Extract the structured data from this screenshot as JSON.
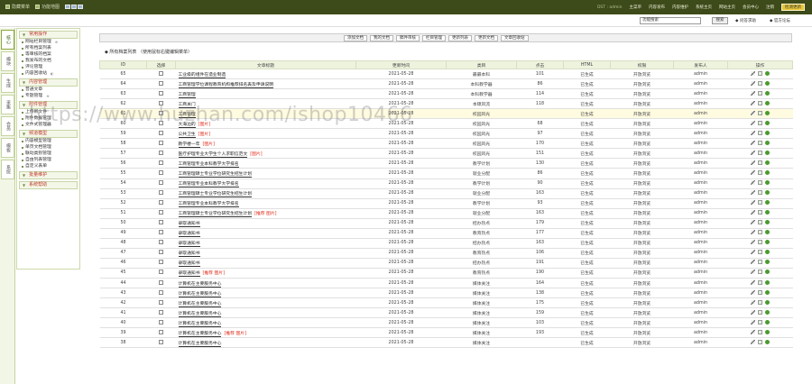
{
  "topbar": {
    "left": [
      "隐藏菜单",
      "功能地图"
    ],
    "user": "DST : admin",
    "links": [
      "主菜单",
      "内容发布",
      "内容维护",
      "系统主页",
      "网站主页",
      "会员中心",
      "注销"
    ],
    "update": "检测更新"
  },
  "searchbar": {
    "value": "功能搜索",
    "button": "搜索",
    "links": [
      "问答求助",
      "官方论坛"
    ]
  },
  "side_tabs": [
    "核心",
    "模块",
    "生成",
    "采集",
    "会员",
    "模板",
    "系统"
  ],
  "menu": [
    {
      "title": "常用操作",
      "items": [
        {
          "label": "网站栏目管理",
          "mark": "⊕"
        },
        {
          "label": "所有档案列表",
          "mark": ""
        },
        {
          "label": "等审核的档案",
          "mark": ""
        },
        {
          "label": "我发布的文档",
          "mark": ""
        },
        {
          "label": "评论管理",
          "mark": ""
        },
        {
          "label": "内容回收站",
          "mark": "◐"
        }
      ]
    },
    {
      "title": "内容管理",
      "items": [
        {
          "label": "普通文章",
          "mark": ""
        },
        {
          "label": "专题管理",
          "mark": "⊕"
        }
      ]
    },
    {
      "title": "附件管理",
      "items": [
        {
          "label": "上传新文件",
          "mark": ""
        },
        {
          "label": "附件数据管理",
          "mark": ""
        },
        {
          "label": "文件式管理器",
          "mark": ""
        }
      ]
    },
    {
      "title": "频道模型",
      "items": [
        {
          "label": "内容模型管理",
          "mark": ""
        },
        {
          "label": "单页文档管理",
          "mark": ""
        },
        {
          "label": "联动类别管理",
          "mark": ""
        },
        {
          "label": "自由列表管理",
          "mark": ""
        },
        {
          "label": "自定义表单",
          "mark": ""
        }
      ]
    },
    {
      "title": "批量维护",
      "items": []
    },
    {
      "title": "系统帮助",
      "items": []
    }
  ],
  "toolbar": [
    "添加文档",
    "我的文档",
    "稿件审核",
    "栏目管理",
    "更新列表",
    "更新文档",
    "文章回收站"
  ],
  "page_title": "◆ 所有档案列表  （使用鼠标右键编辑菜单）",
  "table": {
    "headers": [
      "ID",
      "选择",
      "文章标题",
      "更新时间",
      "类目",
      "点击",
      "HTML",
      "权限",
      "发布人",
      "操作"
    ],
    "rows": [
      {
        "id": "65",
        "title": "工业级的组件在造业制造",
        "flag": "",
        "date": "2021-05-28",
        "cat": "最最本科",
        "hits": "101",
        "html": "已生成",
        "perm": "开放浏览",
        "pub": "admin"
      },
      {
        "id": "64",
        "title": "工商管理学位课程教育机构推荐排名表及申请说明",
        "flag": "",
        "date": "2021-05-28",
        "cat": "本科教学器",
        "hits": "86",
        "html": "已生成",
        "perm": "开放浏览",
        "pub": "admin"
      },
      {
        "id": "63",
        "title": "工商管理",
        "flag": "",
        "date": "2021-05-28",
        "cat": "本科教学器",
        "hits": "114",
        "html": "已生成",
        "perm": "开放浏览",
        "pub": "admin"
      },
      {
        "id": "62",
        "title": "工商关门",
        "flag": "",
        "date": "2021-05-28",
        "cat": "本硕风流",
        "hits": "118",
        "html": "已生成",
        "perm": "开放浏览",
        "pub": "admin"
      },
      {
        "id": "61",
        "title": "工商管理",
        "flag": "",
        "date": "2021-05-28",
        "cat": "校园风光",
        "hits": "",
        "html": "已生成",
        "perm": "开放浏览",
        "pub": "admin"
      },
      {
        "id": "60",
        "title": "大海边的",
        "flag": "[图片]",
        "date": "2021-05-28",
        "cat": "校园风光",
        "hits": "68",
        "html": "已生成",
        "perm": "开放浏览",
        "pub": "admin"
      },
      {
        "id": "59",
        "title": "公共卫生",
        "flag": "[图片]",
        "date": "2021-05-28",
        "cat": "校园风光",
        "hits": "97",
        "html": "已生成",
        "perm": "开放浏览",
        "pub": "admin"
      },
      {
        "id": "58",
        "title": "教学楼一年",
        "flag": "[图片]",
        "date": "2021-05-28",
        "cat": "校园风光",
        "hits": "170",
        "html": "已生成",
        "perm": "开放浏览",
        "pub": "admin"
      },
      {
        "id": "57",
        "title": "医疗护理专业大学生个人求职信范文",
        "flag": "[图片]",
        "date": "2021-05-28",
        "cat": "校园风光",
        "hits": "151",
        "html": "已生成",
        "perm": "开放浏览",
        "pub": "admin"
      },
      {
        "id": "56",
        "title": "工商管理专业本科教学大学排名",
        "flag": "",
        "date": "2021-05-28",
        "cat": "教学计划",
        "hits": "130",
        "html": "已生成",
        "perm": "开放浏览",
        "pub": "admin"
      },
      {
        "id": "55",
        "title": "工商管理硕士专业学位研究生招生计划",
        "flag": "",
        "date": "2021-05-28",
        "cat": "就业分配",
        "hits": "86",
        "html": "已生成",
        "perm": "开放浏览",
        "pub": "admin"
      },
      {
        "id": "54",
        "title": "工商管理专业本科教学大学排名",
        "flag": "",
        "date": "2021-05-28",
        "cat": "教学计划",
        "hits": "90",
        "html": "已生成",
        "perm": "开放浏览",
        "pub": "admin"
      },
      {
        "id": "53",
        "title": "工商管理硕士专业学位研究生招生计划",
        "flag": "",
        "date": "2021-05-28",
        "cat": "就业分配",
        "hits": "163",
        "html": "已生成",
        "perm": "开放浏览",
        "pub": "admin"
      },
      {
        "id": "52",
        "title": "工商管理专业本科教学大学排名",
        "flag": "",
        "date": "2021-05-28",
        "cat": "教学计划",
        "hits": "93",
        "html": "已生成",
        "perm": "开放浏览",
        "pub": "admin"
      },
      {
        "id": "51",
        "title": "工商管理硕士专业学位研究生招生计划",
        "flag": "[推荐 图片]",
        "date": "2021-05-28",
        "cat": "就业分配",
        "hits": "163",
        "html": "已生成",
        "perm": "开放浏览",
        "pub": "admin"
      },
      {
        "id": "50",
        "title": "录取通知书",
        "flag": "",
        "date": "2021-05-28",
        "cat": "招办热点",
        "hits": "179",
        "html": "已生成",
        "perm": "开放浏览",
        "pub": "admin"
      },
      {
        "id": "49",
        "title": "录取通知书",
        "flag": "",
        "date": "2021-05-28",
        "cat": "教育热点",
        "hits": "177",
        "html": "已生成",
        "perm": "开放浏览",
        "pub": "admin"
      },
      {
        "id": "48",
        "title": "录取通知书",
        "flag": "",
        "date": "2021-05-28",
        "cat": "招办热点",
        "hits": "163",
        "html": "已生成",
        "perm": "开放浏览",
        "pub": "admin"
      },
      {
        "id": "47",
        "title": "录取通知书",
        "flag": "",
        "date": "2021-05-28",
        "cat": "教育热点",
        "hits": "106",
        "html": "已生成",
        "perm": "开放浏览",
        "pub": "admin"
      },
      {
        "id": "46",
        "title": "录取通知书",
        "flag": "",
        "date": "2021-05-28",
        "cat": "招办热点",
        "hits": "191",
        "html": "已生成",
        "perm": "开放浏览",
        "pub": "admin"
      },
      {
        "id": "45",
        "title": "录取通知书",
        "flag": "[推荐 图片]",
        "date": "2021-05-28",
        "cat": "教育热点",
        "hits": "190",
        "html": "已生成",
        "perm": "开放浏览",
        "pub": "admin"
      },
      {
        "id": "44",
        "title": "计算机在主要服务中心",
        "flag": "",
        "date": "2021-05-28",
        "cat": "媒体关注",
        "hits": "164",
        "html": "已生成",
        "perm": "开放浏览",
        "pub": "admin"
      },
      {
        "id": "43",
        "title": "计算机在主要服务中心",
        "flag": "",
        "date": "2021-05-28",
        "cat": "媒体关注",
        "hits": "138",
        "html": "已生成",
        "perm": "开放浏览",
        "pub": "admin"
      },
      {
        "id": "42",
        "title": "计算机在主要服务中心",
        "flag": "",
        "date": "2021-05-28",
        "cat": "媒体关注",
        "hits": "175",
        "html": "已生成",
        "perm": "开放浏览",
        "pub": "admin"
      },
      {
        "id": "41",
        "title": "计算机在主要服务中心",
        "flag": "",
        "date": "2021-05-28",
        "cat": "媒体关注",
        "hits": "159",
        "html": "已生成",
        "perm": "开放浏览",
        "pub": "admin"
      },
      {
        "id": "40",
        "title": "计算机在主要服务中心",
        "flag": "",
        "date": "2021-05-28",
        "cat": "媒体关注",
        "hits": "103",
        "html": "已生成",
        "perm": "开放浏览",
        "pub": "admin"
      },
      {
        "id": "39",
        "title": "计算机在主要服务中心",
        "flag": "[推荐 图片]",
        "date": "2021-05-28",
        "cat": "媒体关注",
        "hits": "193",
        "html": "已生成",
        "perm": "开放浏览",
        "pub": "admin"
      },
      {
        "id": "38",
        "title": "计算机在主要服务中心",
        "flag": "",
        "date": "2021-05-28",
        "cat": "媒体关注",
        "hits": "",
        "html": "已生成",
        "perm": "开放浏览",
        "pub": "admin"
      }
    ]
  },
  "watermark": "https://www.huzhan.com/ishop10466"
}
